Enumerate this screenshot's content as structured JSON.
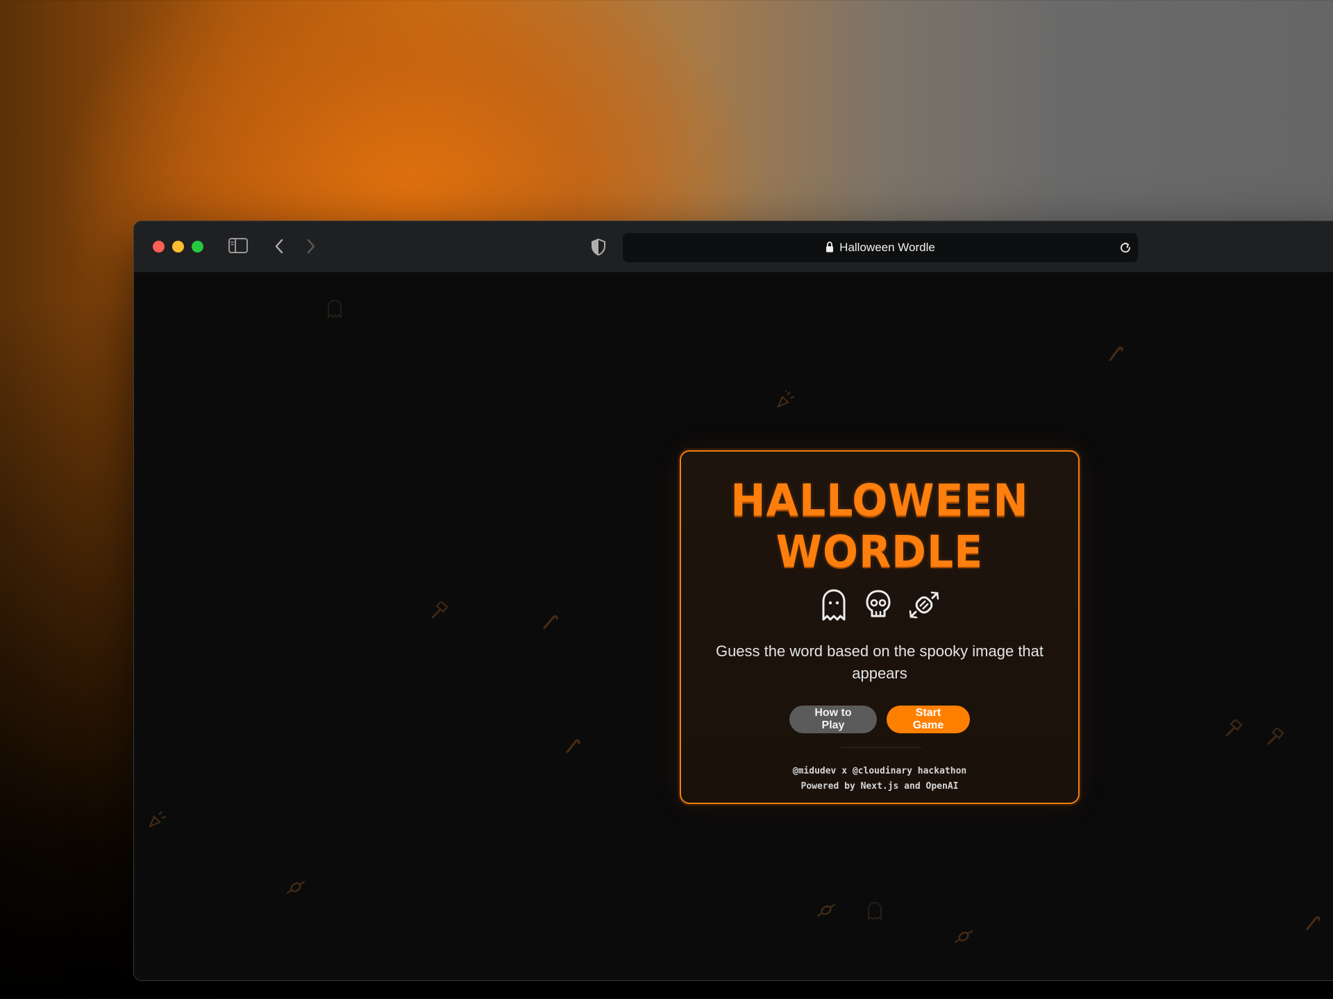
{
  "browser": {
    "tab_title": "Halloween Wordle",
    "icons": [
      "sidebar-icon",
      "back-icon",
      "forward-icon",
      "shield-icon",
      "lock-icon",
      "reload-icon"
    ],
    "traffic_lights": {
      "close": "#ff5f57",
      "minimize": "#febc2e",
      "maximize": "#28c840"
    }
  },
  "card": {
    "title_line1": "HALLOWEEN",
    "title_line2": "WORDLE",
    "icons": [
      "ghost-icon",
      "skull-icon",
      "candy-icon"
    ],
    "tagline": "Guess the word based on the spooky image that appears",
    "how_to_play_label": "How to Play",
    "start_game_label": "Start Game",
    "footer_line1": "@midudev x @cloudinary hackathon",
    "footer_line2": "Powered by Next.js and OpenAI"
  },
  "colors": {
    "accent": "#ff7f0e",
    "page_bg": "#0b0b0b",
    "card_border": "#f2810f",
    "secondary_button": "#5b5b5b"
  },
  "background_decorations": [
    "ghost-icon",
    "candy-cane-icon",
    "confetti-icon",
    "hammer-icon",
    "candy-icon"
  ]
}
